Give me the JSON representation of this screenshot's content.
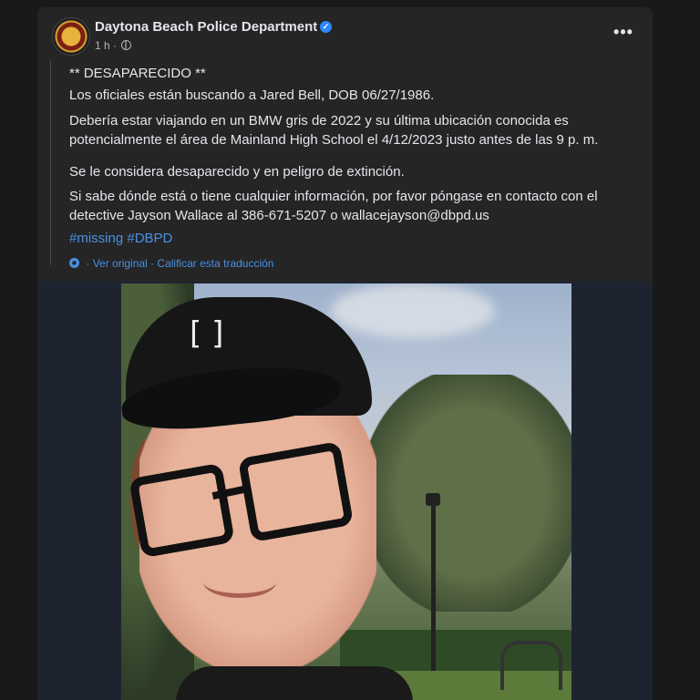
{
  "post": {
    "author": "Daytona Beach Police Department",
    "time": "1 h",
    "title_line": "** DESAPARECIDO **",
    "p1": "Los oficiales están buscando a Jared Bell, DOB 06/27/1986.",
    "p2": "Debería estar viajando en un BMW gris de 2022 y su última ubicación conocida es potencialmente el área de Mainland High School el 4/12/2023 justo antes de las 9 p. m.",
    "p3": "Se le considera desaparecido y en peligro de extinción.",
    "p4": "Si sabe dónde está o tiene cualquier información, por favor póngase en contacto con el detective Jayson Wallace al 386-671-5207 o wallacejayson@dbpd.us",
    "hashtags": "#missing #DBPD",
    "see_original": "Ver original",
    "rate_translation": "Calificar esta traducción",
    "separator": "·",
    "more_glyph": "•••"
  },
  "icons": {
    "verified": "verified-badge-icon",
    "privacy": "globe-icon",
    "translate": "gear-icon",
    "more": "more-options-icon"
  },
  "colors": {
    "card_bg": "#252526",
    "page_bg": "#19191a",
    "link": "#4a90e2",
    "verified": "#2d88ff"
  }
}
